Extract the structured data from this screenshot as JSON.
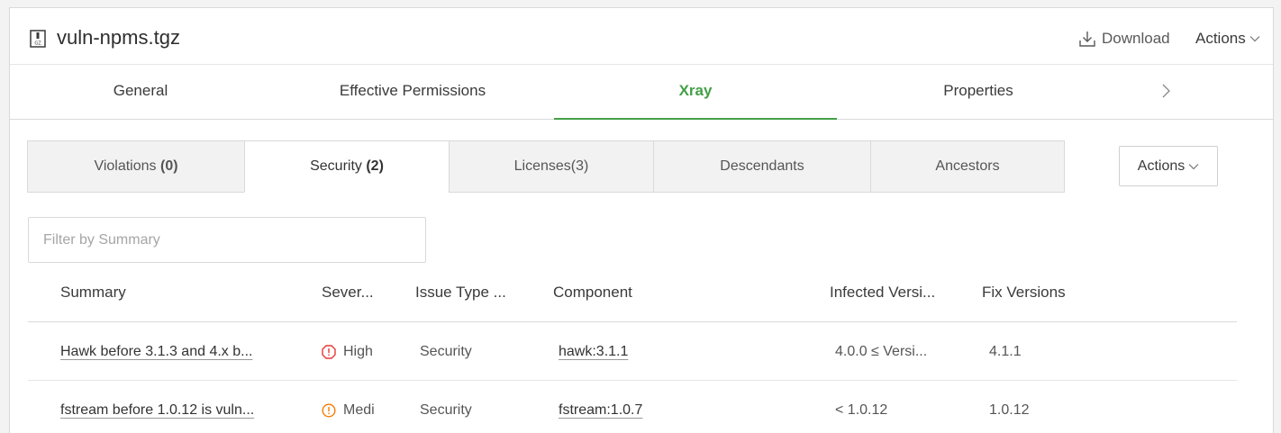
{
  "header": {
    "file_name": "vuln-npms.tgz",
    "file_icon": "archive-file-icon",
    "download_label": "Download",
    "actions_label": "Actions"
  },
  "tabs": [
    {
      "label": "General",
      "active": false
    },
    {
      "label": "Effective Permissions",
      "active": false
    },
    {
      "label": "Xray",
      "active": true
    },
    {
      "label": "Properties",
      "active": false
    }
  ],
  "subtabs": [
    {
      "label": "Violations",
      "count": "(0)",
      "active": false
    },
    {
      "label": "Security",
      "count": "(2)",
      "active": true
    },
    {
      "label": "Licenses(3)",
      "count": "",
      "active": false
    },
    {
      "label": "Descendants",
      "count": "",
      "active": false
    },
    {
      "label": "Ancestors",
      "count": "",
      "active": false
    }
  ],
  "actions_button": {
    "label": "Actions"
  },
  "filter": {
    "placeholder": "Filter by Summary",
    "value": ""
  },
  "table": {
    "columns": [
      "Summary",
      "Sever...",
      "Issue Type ...",
      "Component",
      "Infected Versi...",
      "Fix Versions"
    ],
    "rows": [
      {
        "summary": "Hawk before 3.1.3 and 4.x b...",
        "severity": "High",
        "issue_type": "Security",
        "component": "hawk:3.1.1",
        "infected": "4.0.0 ≤ Versi...",
        "fix": "4.1.1"
      },
      {
        "summary": "fstream before 1.0.12 is vuln...",
        "severity": "Medi",
        "issue_type": "Security",
        "component": "fstream:1.0.7",
        "infected": "< 1.0.12",
        "fix": "1.0.12"
      }
    ]
  },
  "colors": {
    "accent": "#43a047",
    "severity_high": "#e53935",
    "severity_medium": "#f57c00"
  }
}
